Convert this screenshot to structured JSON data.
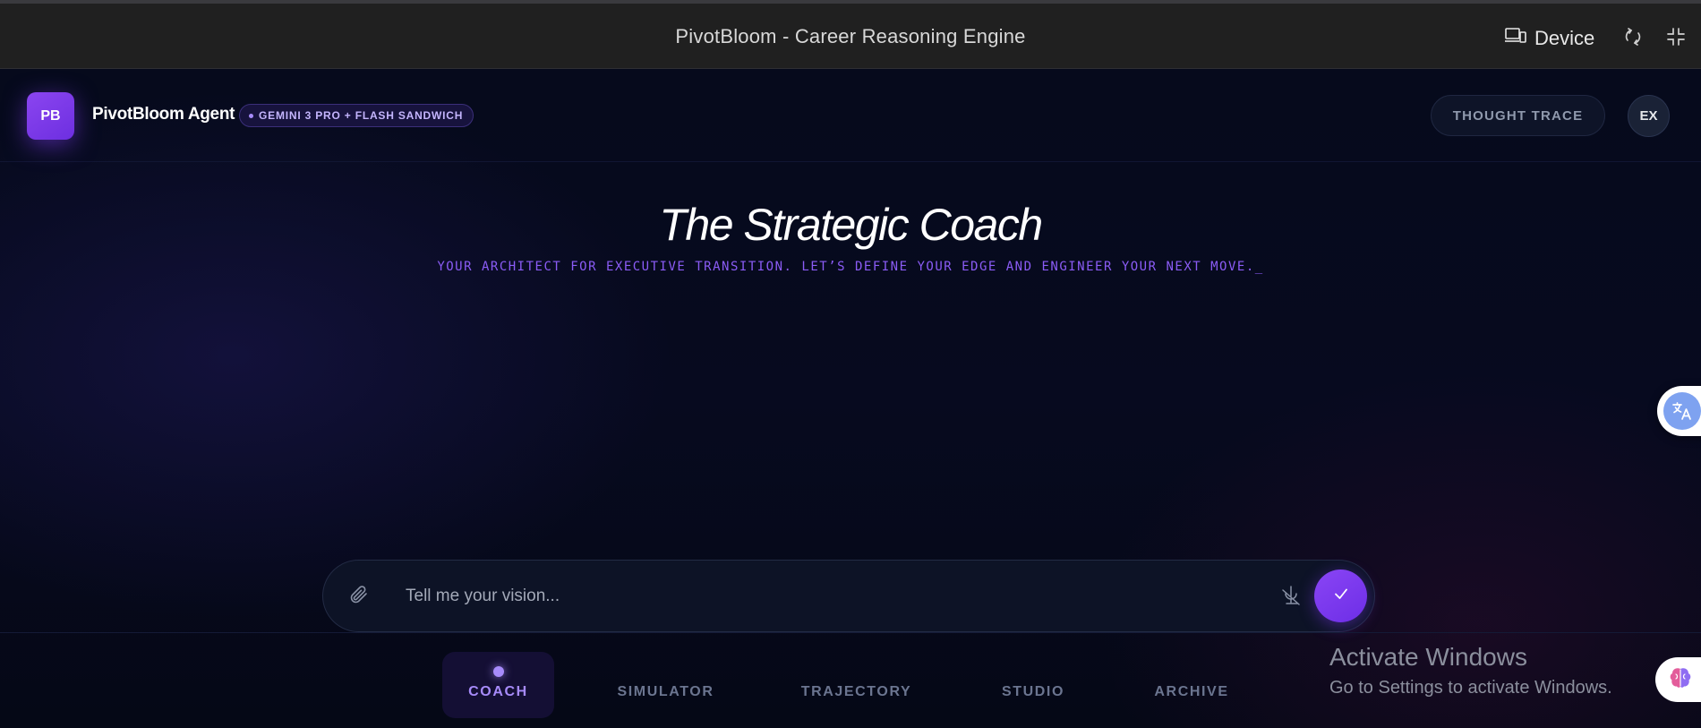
{
  "window": {
    "title": "PivotBloom - Career Reasoning Engine",
    "device_label": "Device"
  },
  "app": {
    "logo_initials": "PB",
    "agent_name": "PivotBloom Agent",
    "model_badge": "GEMINI 3 PRO + FLASH SANDWICH",
    "thought_trace_label": "THOUGHT TRACE",
    "user_initials": "EX"
  },
  "hero": {
    "title": "The Strategic Coach",
    "subtitle": "YOUR ARCHITECT FOR EXECUTIVE TRANSITION. LET’S DEFINE YOUR EDGE AND ENGINEER YOUR NEXT MOVE._"
  },
  "prompt": {
    "placeholder": "Tell me your vision...",
    "value": ""
  },
  "nav": {
    "tabs": [
      {
        "label": "COACH",
        "active": true
      },
      {
        "label": "SIMULATOR",
        "active": false
      },
      {
        "label": "TRAJECTORY",
        "active": false
      },
      {
        "label": "STUDIO",
        "active": false
      },
      {
        "label": "ARCHIVE",
        "active": false
      }
    ]
  },
  "os_watermark": {
    "title": "Activate Windows",
    "subtitle": "Go to Settings to activate Windows."
  },
  "colors": {
    "accent": "#7c3aed",
    "accent_light": "#a78bfa",
    "background": "#050816"
  },
  "icons": {
    "device": "devices-icon",
    "rotate": "rotate-icon",
    "fullscreen": "fullscreen-exit-icon",
    "attach": "paperclip-icon",
    "mic": "microphone-icon",
    "send": "check-icon",
    "translate": "translate-icon",
    "brain": "brain-icon"
  }
}
